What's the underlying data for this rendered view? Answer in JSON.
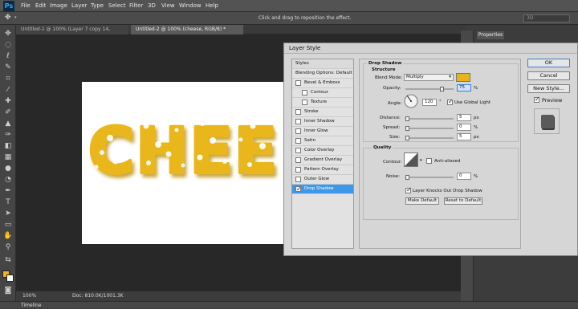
{
  "app": {
    "logo": "Ps"
  },
  "menu": [
    "File",
    "Edit",
    "Image",
    "Layer",
    "Type",
    "Select",
    "Filter",
    "3D",
    "View",
    "Window",
    "Help"
  ],
  "options_bar": {
    "message": "Click and drag to reposition the effect.",
    "preset": "3D"
  },
  "tabs": [
    {
      "label": "Untitled-1 @ 100% (Layer 7 copy 14, RGB/8) *"
    },
    {
      "label": "Untitled-2 @ 100% (cheese, RGB/8) *"
    }
  ],
  "canvas": {
    "text": "CHEE"
  },
  "status_bar": {
    "zoom": "100%",
    "doc": "Doc: 810.0K/1001.3K"
  },
  "timeline": {
    "label": "Timeline"
  },
  "right_panel": {
    "tab": "Properties"
  },
  "colors": {
    "foreground": "#f0b41b",
    "background": "#ffffff",
    "accent": "#3f97e8"
  },
  "dialog": {
    "title": "Layer Style",
    "styles_header": "Styles",
    "blending_options": "Blending Options: Default",
    "styles": [
      {
        "label": "Bevel & Emboss",
        "checked": false
      },
      {
        "label": "Contour",
        "checked": false,
        "sub": true
      },
      {
        "label": "Texture",
        "checked": false,
        "sub": true
      },
      {
        "label": "Stroke",
        "checked": false
      },
      {
        "label": "Inner Shadow",
        "checked": false
      },
      {
        "label": "Inner Glow",
        "checked": false
      },
      {
        "label": "Satin",
        "checked": false
      },
      {
        "label": "Color Overlay",
        "checked": false
      },
      {
        "label": "Gradient Overlay",
        "checked": false
      },
      {
        "label": "Pattern Overlay",
        "checked": false
      },
      {
        "label": "Outer Glow",
        "checked": false
      },
      {
        "label": "Drop Shadow",
        "checked": true,
        "selected": true
      }
    ],
    "drop_shadow": {
      "title": "Drop Shadow",
      "structure_title": "Structure",
      "blend_mode_label": "Blend Mode:",
      "blend_mode": "Multiply",
      "shadow_color": "#e8b41d",
      "opacity_label": "Opacity:",
      "opacity": "75",
      "angle_label": "Angle:",
      "angle": "120",
      "angle_unit": "°",
      "global_light_label": "Use Global Light",
      "distance_label": "Distance:",
      "distance": "5",
      "spread_label": "Spread:",
      "spread": "0",
      "size_label": "Size:",
      "size": "5",
      "quality_title": "Quality",
      "contour_label": "Contour:",
      "anti_aliased_label": "Anti-aliased",
      "noise_label": "Noise:",
      "noise": "0",
      "layer_knocks_label": "Layer Knocks Out Drop Shadow",
      "make_default": "Make Default",
      "reset_default": "Reset to Default",
      "unit_percent": "%",
      "unit_px": "px"
    },
    "buttons": {
      "ok": "OK",
      "cancel": "Cancel",
      "new_style": "New Style..."
    },
    "preview_label": "Preview"
  }
}
